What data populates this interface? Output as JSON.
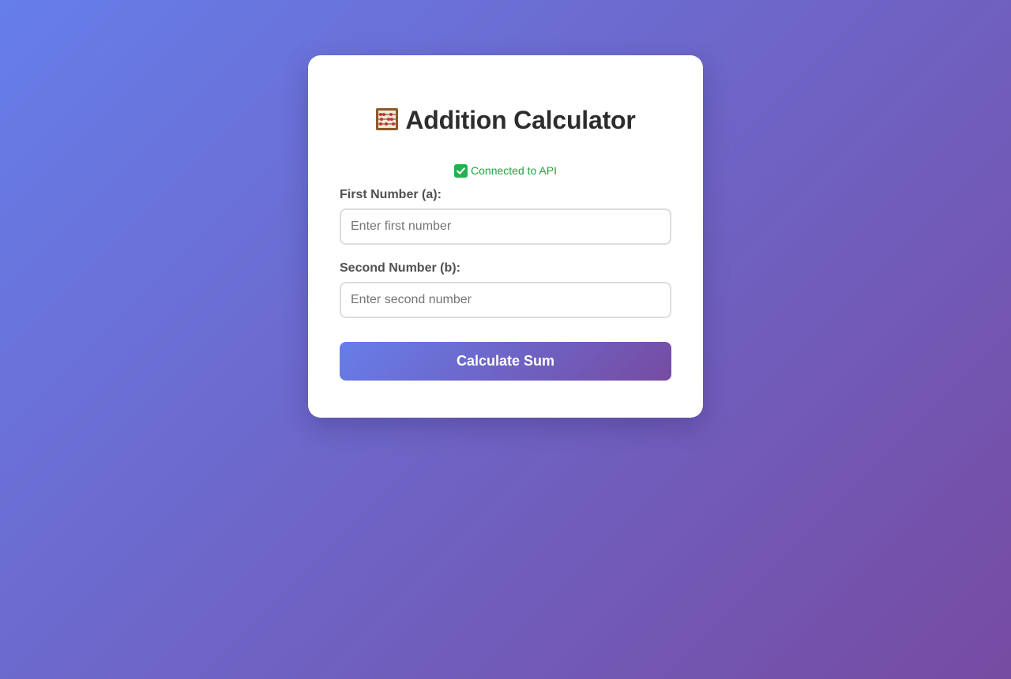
{
  "header": {
    "title": "Addition Calculator",
    "title_icon": "abacus-icon"
  },
  "status": {
    "icon": "check-mark-icon",
    "text": "Connected to API",
    "color": "#21a33f"
  },
  "form": {
    "first": {
      "label": "First Number (a):",
      "value": "",
      "placeholder": "Enter first number"
    },
    "second": {
      "label": "Second Number (b):",
      "value": "",
      "placeholder": "Enter second number"
    },
    "submit_label": "Calculate Sum"
  },
  "colors": {
    "gradient_start": "#667eea",
    "gradient_end": "#764ba2",
    "card": "#ffffff",
    "heading": "#2d2d2d",
    "label": "#505050"
  }
}
